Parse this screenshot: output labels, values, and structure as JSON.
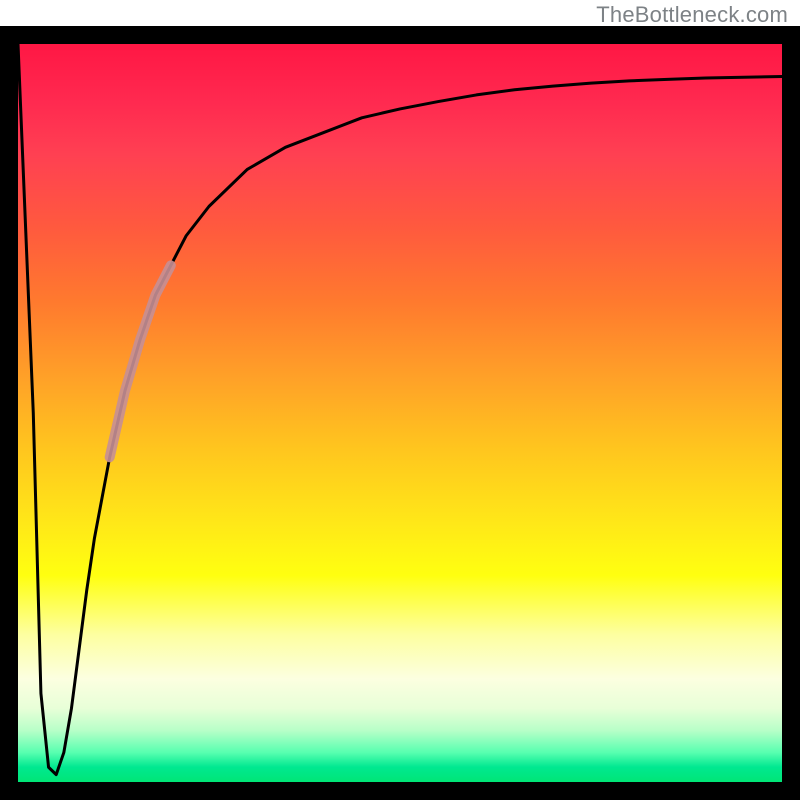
{
  "watermark": "TheBottleneck.com",
  "chart_data": {
    "type": "line",
    "title": "",
    "xlabel": "",
    "ylabel": "",
    "xlim": [
      0,
      100
    ],
    "ylim": [
      0,
      100
    ],
    "grid": false,
    "series": [
      {
        "name": "curve",
        "x": [
          0,
          2,
          3,
          4,
          5,
          6,
          7,
          8,
          9,
          10,
          12,
          14,
          16,
          18,
          20,
          22,
          25,
          30,
          35,
          40,
          45,
          50,
          55,
          60,
          65,
          70,
          75,
          80,
          85,
          90,
          95,
          100
        ],
        "values": [
          100,
          50,
          12,
          2,
          1,
          4,
          10,
          18,
          26,
          33,
          44,
          53,
          60,
          66,
          70,
          74,
          78,
          83,
          86,
          88,
          90,
          91.2,
          92.2,
          93.1,
          93.8,
          94.3,
          94.7,
          95.0,
          95.2,
          95.4,
          95.5,
          95.6
        ]
      },
      {
        "name": "highlight-segment",
        "x": [
          12,
          14,
          16,
          18,
          20
        ],
        "values": [
          44,
          53,
          60,
          66,
          70
        ]
      }
    ],
    "annotations": [],
    "colors": {
      "curve_stroke": "#000000",
      "highlight_stroke": "#c78f95",
      "gradient_top": "#ff1744",
      "gradient_mid": "#ffe818",
      "gradient_bottom": "#00e676",
      "frame_border": "#000000"
    }
  }
}
